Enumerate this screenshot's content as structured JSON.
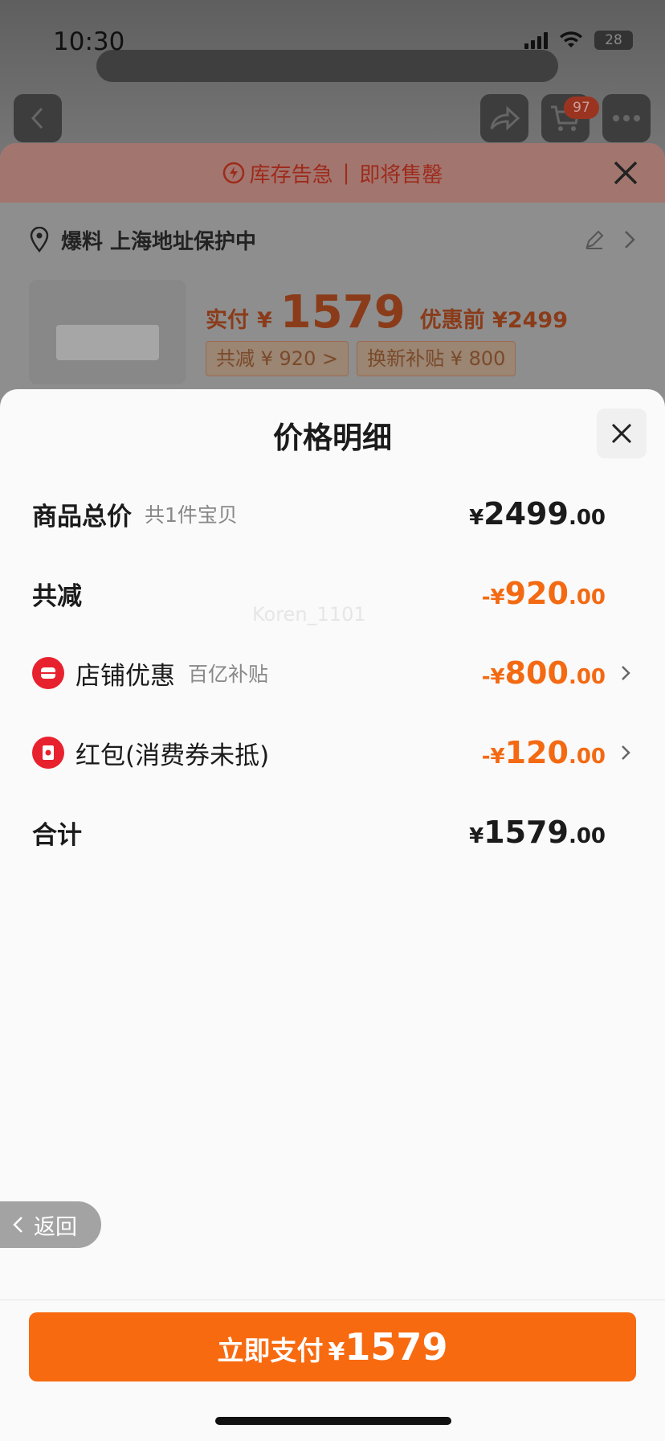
{
  "status_bar": {
    "time": "10:30",
    "battery": "28"
  },
  "nav": {
    "cart_badge": "97"
  },
  "sku_panel": {
    "stock_alert_1": "库存告急",
    "stock_alert_2": "即将售罄",
    "address": "爆料 上海地址保护中",
    "paid_label": "实付",
    "paid_currency": "¥",
    "paid_amount": "1579",
    "before_discount": "优惠前 ¥2499",
    "chips": [
      "共减 ¥ 920 >",
      "换新补贴 ¥ 800"
    ]
  },
  "sheet": {
    "title": "价格明细",
    "watermark": "Koren_1101",
    "rows": [
      {
        "name": "商品总价",
        "sub": "共1件宝贝",
        "sign": "¥",
        "int": "2499",
        "dec": ".00"
      },
      {
        "name": "共减",
        "sub": "",
        "sign": "-¥",
        "int": "920",
        "dec": ".00"
      },
      {
        "name": "店铺优惠",
        "sub": "百亿补贴",
        "sign": "-¥",
        "int": "800",
        "dec": ".00"
      },
      {
        "name": "红包(消费券未抵)",
        "sub": "",
        "sign": "-¥",
        "int": "120",
        "dec": ".00"
      },
      {
        "name": "合计",
        "sub": "",
        "sign": "¥",
        "int": "1579",
        "dec": ".00"
      }
    ],
    "back_label": "返回",
    "pay_button": {
      "label": "立即支付",
      "currency": "¥",
      "amount": "1579"
    }
  },
  "colors": {
    "accent": "#f86a10",
    "discount": "#f36a12",
    "badge_red": "#e8212e"
  }
}
